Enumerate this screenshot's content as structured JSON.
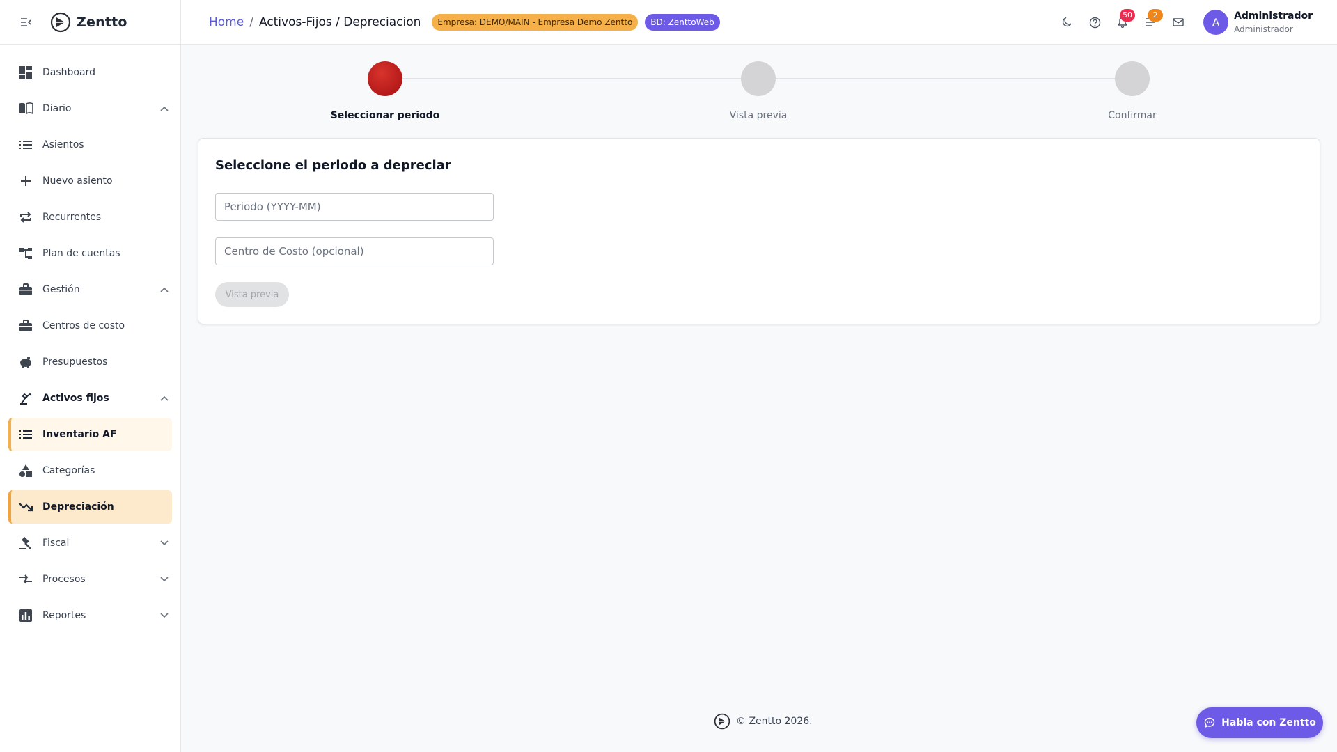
{
  "brand": {
    "name": "Zentto",
    "logo_icon": "zentto-logo-icon",
    "menu_icon": "menu-collapse-icon"
  },
  "sidebar": {
    "items": [
      {
        "label": "Dashboard",
        "icon": "dashboard-icon"
      },
      {
        "label": "Diario",
        "icon": "book-open-icon",
        "expanded": true
      },
      {
        "label": "Asientos",
        "icon": "list-icon"
      },
      {
        "label": "Nuevo asiento",
        "icon": "plus-icon"
      },
      {
        "label": "Recurrentes",
        "icon": "repeat-icon"
      },
      {
        "label": "Plan de cuentas",
        "icon": "account-tree-icon"
      },
      {
        "label": "Gestión",
        "icon": "briefcase-icon",
        "expanded": true
      },
      {
        "label": "Centros de costo",
        "icon": "briefcase-icon"
      },
      {
        "label": "Presupuestos",
        "icon": "piggy-bank-icon"
      },
      {
        "label": "Activos fijos",
        "icon": "precision-tool-icon",
        "expanded": true
      },
      {
        "label": "Inventario AF",
        "icon": "list-icon"
      },
      {
        "label": "Categorías",
        "icon": "category-shapes-icon"
      },
      {
        "label": "Depreciación",
        "icon": "trending-down-icon"
      },
      {
        "label": "Fiscal",
        "icon": "gavel-icon",
        "expanded": false
      },
      {
        "label": "Procesos",
        "icon": "compare-arrows-icon",
        "expanded": false
      },
      {
        "label": "Reportes",
        "icon": "bar-chart-icon",
        "expanded": false
      }
    ]
  },
  "header": {
    "breadcrumb_home": "Home",
    "breadcrumb_separator": "/",
    "breadcrumb_current": "Activos-Fijos / Depreciacion",
    "empresa_chip": "Empresa: DEMO/MAIN - Empresa Demo Zentto",
    "db_chip": "BD: ZenttoWeb",
    "notifications_count": "50",
    "tasks_count": "2",
    "user_initial": "A",
    "user_name": "Administrador",
    "user_role": "Administrador"
  },
  "stepper": {
    "steps": [
      {
        "label": "Seleccionar periodo",
        "state": "active"
      },
      {
        "label": "Vista previa",
        "state": "pending"
      },
      {
        "label": "Confirmar",
        "state": "pending"
      }
    ]
  },
  "form": {
    "title": "Seleccione el periodo a depreciar",
    "periodo_placeholder": "Periodo (YYYY-MM)",
    "centro_placeholder": "Centro de Costo (opcional)",
    "preview_button": "Vista previa"
  },
  "footer": {
    "text": "© Zentto 2026."
  },
  "chat": {
    "label": "Habla con Zentto"
  },
  "colors": {
    "accent": "#6d5ae6",
    "highlight": "#f5b04a",
    "active_step": "#b5151a",
    "badge_red": "#ef2b4f",
    "badge_orange": "#f08519"
  }
}
